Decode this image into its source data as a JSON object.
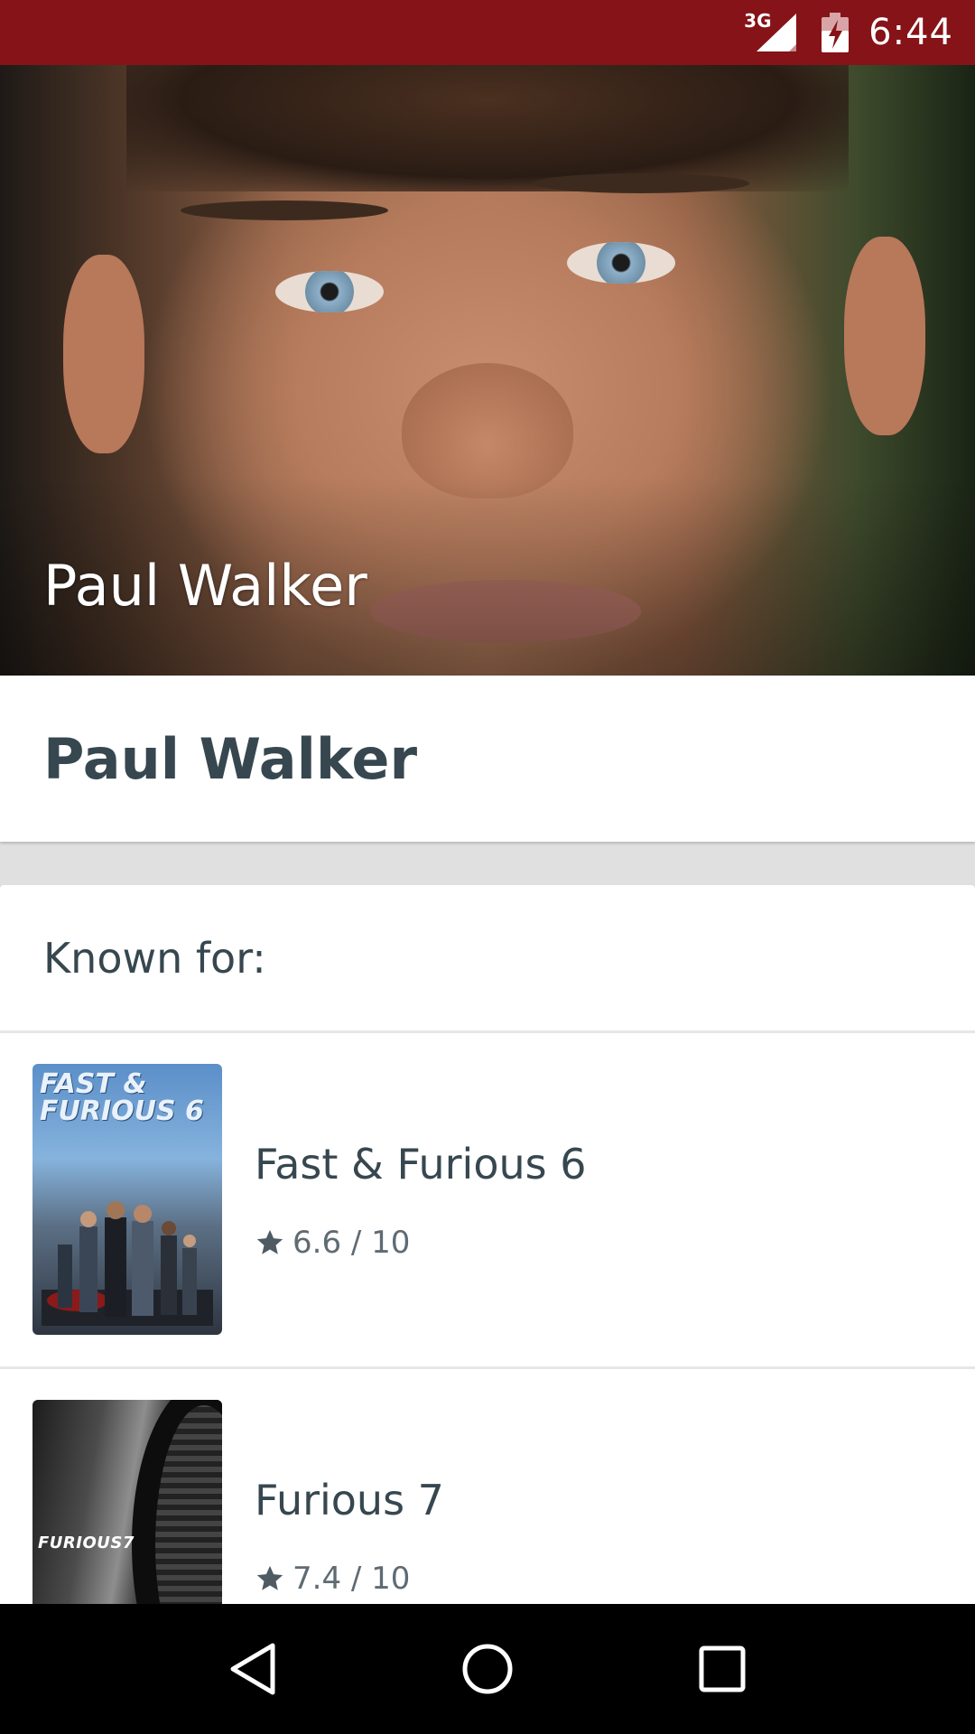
{
  "status_bar": {
    "network": "3G",
    "time": "6:44"
  },
  "person": {
    "hero_name": "Paul Walker",
    "name": "Paul Walker"
  },
  "known_for": {
    "label": "Known for:",
    "movies": [
      {
        "title": "Fast & Furious 6",
        "rating": "6.6 / 10",
        "poster_text": "FAST & FURIOUS 6"
      },
      {
        "title": "Furious 7",
        "rating": "7.4 / 10",
        "poster_text": "FURIOUS7"
      }
    ]
  },
  "colors": {
    "status_bar": "#861317",
    "text_primary": "#37474f",
    "text_secondary": "#5f6b73",
    "background": "#e0e0e0",
    "nav_bar": "#000000"
  },
  "icons": {
    "signal": "signal-icon",
    "battery": "battery-charging-icon",
    "rating": "star-icon",
    "back": "back-icon",
    "home": "home-icon",
    "recents": "recents-icon"
  }
}
